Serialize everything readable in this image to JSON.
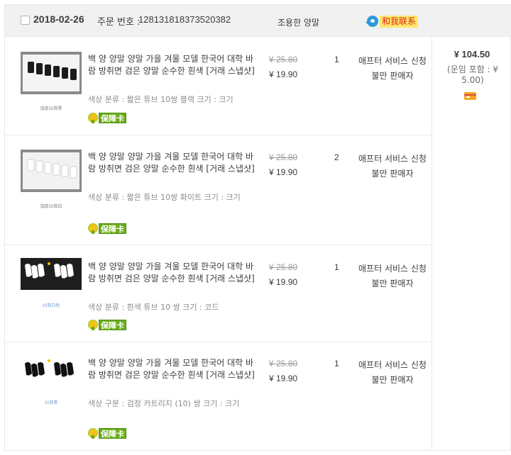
{
  "header": {
    "date": "2018-02-26",
    "order_no_label": "주문 번호 :",
    "order_no": "128131818373520382",
    "shop_name": "조용한 양말",
    "contact_label": "和我联系"
  },
  "items": [
    {
      "title": "백 양 양말 양말 가을 겨울 모델 한국어 대학 바람 방취면 검은 양말 순수한 흰색 [거래 스냅샷]",
      "spec": "색상 분류 : 짧은 튜브 10쌍 블랙    크기 : 크기",
      "thumb_caption": "加厚10双黑",
      "thumb_style": "box-black",
      "badge": "保障卡",
      "old_price": "¥ 25.80",
      "price": "¥ 19.90",
      "qty": "1",
      "service": "애프터 서비스 신청",
      "complaint": "불만 판매자"
    },
    {
      "title": "백 양 양말 양말 가을 겨울 모델 한국어 대학 바람 방취면 검은 양말 순수한 흰색 [거래 스냅샷]",
      "spec": "색상 분류 : 짧은 튜브 10쌍 화이트    크기 : 크기",
      "thumb_caption": "加厚10双白",
      "thumb_style": "box-white",
      "badge": "保障卡",
      "old_price": "¥ 25.80",
      "price": "¥ 19.90",
      "qty": "2",
      "service": "애프터 서비스 신청",
      "complaint": "불만 판매자"
    },
    {
      "title": "백 양 양말 양말 가을 겨울 모델 한국어 대학 바람 방취면 검은 양말 순수한 흰색 [거래 스냅샷]",
      "spec": "색상 분류 : 흰색 튜브 10 쌍    크기 : 코드",
      "thumb_caption": "10双白色",
      "thumb_style": "white-on-dark",
      "badge": "保障卡",
      "old_price": "¥ 25.80",
      "price": "¥ 19.90",
      "qty": "1",
      "service": "애프터 서비스 신청",
      "complaint": "불만 판매자"
    },
    {
      "title": "백 양 양말 양말 가을 겨울 모델 한국어 대학 바람 방취면 검은 양말 순수한 흰색 [거래 스냅샷]",
      "spec": "색상 구분 : 검정 카트리지 (10) 쌍    크기 : 크기",
      "thumb_caption": "10双黑",
      "thumb_style": "black-on-white",
      "badge": "保障卡",
      "old_price": "¥ 25.80",
      "price": "¥ 19.90",
      "qty": "1",
      "service": "애프터 서비스 신청",
      "complaint": "불만 판매자"
    }
  ],
  "summary": {
    "total": "¥ 104.50",
    "shipping": "(운임 포함 : ¥ 5.00)"
  }
}
